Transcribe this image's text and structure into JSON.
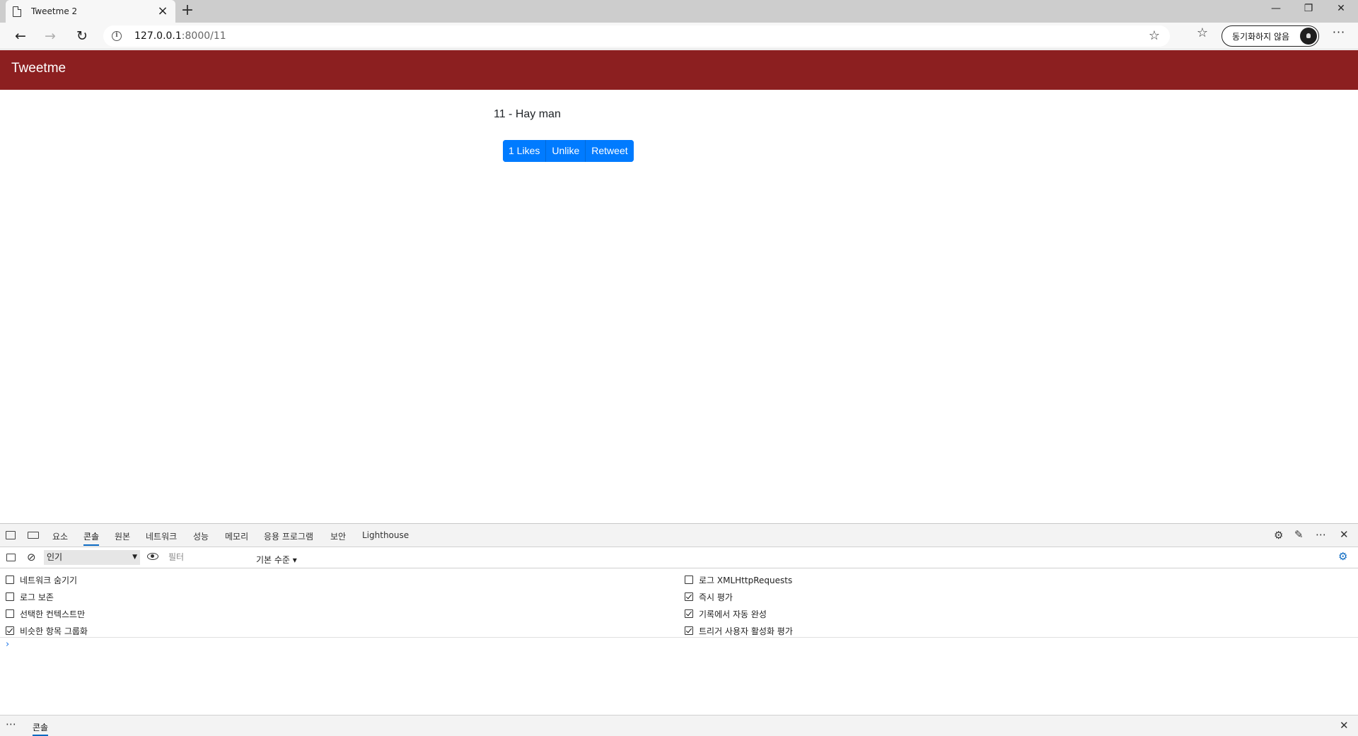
{
  "browser": {
    "tab_title": "Tweetme 2",
    "new_tab": "+",
    "url_host": "127.0.0.1",
    "url_path": ":8000/11",
    "sync_label": "동기화하지 않음",
    "window_controls": {
      "minimize": "—",
      "restore": "❐",
      "close": "✕"
    }
  },
  "page": {
    "brand": "Tweetme",
    "tweet_text": "11 - Hay man",
    "buttons": {
      "likes": "1 Likes",
      "unlike": "Unlike",
      "retweet": "Retweet"
    }
  },
  "devtools": {
    "tabs": [
      "요소",
      "콘솔",
      "원본",
      "네트워크",
      "성능",
      "메모리",
      "응용 프로그램",
      "보안",
      "Lighthouse"
    ],
    "active_tab": "콘솔",
    "context_select": "인기",
    "filter_placeholder": "필터",
    "level_label": "기본 수준 ▾",
    "options_left": [
      {
        "label": "네트워크 숨기기",
        "checked": false
      },
      {
        "label": "로그 보존",
        "checked": false
      },
      {
        "label": "선택한 컨텍스트만",
        "checked": false
      },
      {
        "label": "비슷한 항목 그룹화",
        "checked": true
      }
    ],
    "options_right": [
      {
        "label": "로그 XMLHttpRequests",
        "checked": false
      },
      {
        "label": "즉시 평가",
        "checked": true
      },
      {
        "label": "기록에서 자동 완성",
        "checked": true
      },
      {
        "label": "트리거 사용자 활성화 평가",
        "checked": true
      }
    ],
    "prompt": "›",
    "drawer_tab": "콘솔"
  },
  "icons": {
    "back": "arrow-left-icon",
    "forward": "arrow-right-icon",
    "reload": "reload-icon",
    "favorite": "star-icon",
    "favorites": "favorites-list-icon",
    "more": "ellipsis-icon",
    "inspect": "inspect-element-icon",
    "device": "device-toolbar-icon",
    "settings": "gear-icon"
  },
  "colors": {
    "navbar": "#8c1f20",
    "button": "#007bff",
    "devtools_accent": "#0a69c2"
  }
}
